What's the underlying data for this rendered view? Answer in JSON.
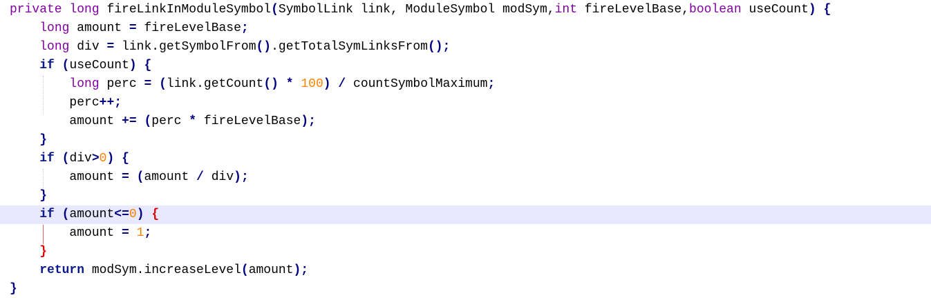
{
  "editor": {
    "language": "java",
    "current_line_index": 11,
    "colors": {
      "keyword_type": "#8000a0",
      "keyword_control": "#0a1a8c",
      "number": "#ff8000",
      "operator": "#000080",
      "text": "#000000",
      "matching_brace": "#e00000",
      "current_line_bg": "#e8e8ff"
    },
    "lines": [
      [
        {
          "t": "private",
          "c": "kw-purple"
        },
        {
          "t": " ",
          "c": "plain"
        },
        {
          "t": "long",
          "c": "kw-purple"
        },
        {
          "t": " fireLinkInModuleSymbol",
          "c": "plain"
        },
        {
          "t": "(",
          "c": "op"
        },
        {
          "t": "SymbolLink link, ModuleSymbol modSym,",
          "c": "plain"
        },
        {
          "t": "int",
          "c": "kw-purple"
        },
        {
          "t": " fireLevelBase,",
          "c": "plain"
        },
        {
          "t": "boolean",
          "c": "kw-purple"
        },
        {
          "t": " useCount",
          "c": "plain"
        },
        {
          "t": ")",
          "c": "op"
        },
        {
          "t": " ",
          "c": "plain"
        },
        {
          "t": "{",
          "c": "op"
        }
      ],
      [
        {
          "t": "    ",
          "c": "plain"
        },
        {
          "t": "long",
          "c": "kw-purple"
        },
        {
          "t": " amount ",
          "c": "plain"
        },
        {
          "t": "=",
          "c": "op"
        },
        {
          "t": " fireLevelBase",
          "c": "plain"
        },
        {
          "t": ";",
          "c": "op"
        }
      ],
      [
        {
          "t": "    ",
          "c": "plain"
        },
        {
          "t": "long",
          "c": "kw-purple"
        },
        {
          "t": " div ",
          "c": "plain"
        },
        {
          "t": "=",
          "c": "op"
        },
        {
          "t": " link.getSymbolFrom",
          "c": "plain"
        },
        {
          "t": "()",
          "c": "op"
        },
        {
          "t": ".getTotalSymLinksFrom",
          "c": "plain"
        },
        {
          "t": "();",
          "c": "op"
        }
      ],
      [
        {
          "t": "    ",
          "c": "plain"
        },
        {
          "t": "if",
          "c": "kw-navy"
        },
        {
          "t": " ",
          "c": "plain"
        },
        {
          "t": "(",
          "c": "op"
        },
        {
          "t": "useCount",
          "c": "plain"
        },
        {
          "t": ")",
          "c": "op"
        },
        {
          "t": " ",
          "c": "plain"
        },
        {
          "t": "{",
          "c": "op"
        }
      ],
      [
        {
          "t": "        ",
          "c": "plain"
        },
        {
          "t": "long",
          "c": "kw-purple"
        },
        {
          "t": " perc ",
          "c": "plain"
        },
        {
          "t": "=",
          "c": "op"
        },
        {
          "t": " ",
          "c": "plain"
        },
        {
          "t": "(",
          "c": "op"
        },
        {
          "t": "link.getCount",
          "c": "plain"
        },
        {
          "t": "()",
          "c": "op"
        },
        {
          "t": " ",
          "c": "plain"
        },
        {
          "t": "*",
          "c": "op"
        },
        {
          "t": " ",
          "c": "plain"
        },
        {
          "t": "100",
          "c": "num"
        },
        {
          "t": ")",
          "c": "op"
        },
        {
          "t": " ",
          "c": "plain"
        },
        {
          "t": "/",
          "c": "op"
        },
        {
          "t": " countSymbolMaximum",
          "c": "plain"
        },
        {
          "t": ";",
          "c": "op"
        }
      ],
      [
        {
          "t": "        ",
          "c": "plain"
        },
        {
          "t": "perc",
          "c": "plain"
        },
        {
          "t": "++;",
          "c": "op"
        }
      ],
      [
        {
          "t": "        ",
          "c": "plain"
        },
        {
          "t": "amount ",
          "c": "plain"
        },
        {
          "t": "+=",
          "c": "op"
        },
        {
          "t": " ",
          "c": "plain"
        },
        {
          "t": "(",
          "c": "op"
        },
        {
          "t": "perc ",
          "c": "plain"
        },
        {
          "t": "*",
          "c": "op"
        },
        {
          "t": " fireLevelBase",
          "c": "plain"
        },
        {
          "t": ");",
          "c": "op"
        }
      ],
      [
        {
          "t": "    ",
          "c": "plain"
        },
        {
          "t": "}",
          "c": "op"
        }
      ],
      [
        {
          "t": "    ",
          "c": "plain"
        },
        {
          "t": "if",
          "c": "kw-navy"
        },
        {
          "t": " ",
          "c": "plain"
        },
        {
          "t": "(",
          "c": "op"
        },
        {
          "t": "div",
          "c": "plain"
        },
        {
          "t": ">",
          "c": "op"
        },
        {
          "t": "0",
          "c": "num"
        },
        {
          "t": ")",
          "c": "op"
        },
        {
          "t": " ",
          "c": "plain"
        },
        {
          "t": "{",
          "c": "op"
        }
      ],
      [
        {
          "t": "        ",
          "c": "plain"
        },
        {
          "t": "amount ",
          "c": "plain"
        },
        {
          "t": "=",
          "c": "op"
        },
        {
          "t": " ",
          "c": "plain"
        },
        {
          "t": "(",
          "c": "op"
        },
        {
          "t": "amount ",
          "c": "plain"
        },
        {
          "t": "/",
          "c": "op"
        },
        {
          "t": " div",
          "c": "plain"
        },
        {
          "t": ");",
          "c": "op"
        }
      ],
      [
        {
          "t": "    ",
          "c": "plain"
        },
        {
          "t": "}",
          "c": "op"
        }
      ],
      [
        {
          "t": "    ",
          "c": "plain"
        },
        {
          "t": "if",
          "c": "kw-navy"
        },
        {
          "t": " ",
          "c": "plain"
        },
        {
          "t": "(",
          "c": "op"
        },
        {
          "t": "amount",
          "c": "plain"
        },
        {
          "t": "<=",
          "c": "op"
        },
        {
          "t": "0",
          "c": "num"
        },
        {
          "t": ")",
          "c": "op"
        },
        {
          "t": " ",
          "c": "plain"
        },
        {
          "t": "{",
          "c": "brace-red"
        }
      ],
      [
        {
          "t": "        ",
          "c": "plain"
        },
        {
          "t": "amount ",
          "c": "plain"
        },
        {
          "t": "=",
          "c": "op"
        },
        {
          "t": " ",
          "c": "plain"
        },
        {
          "t": "1",
          "c": "num"
        },
        {
          "t": ";",
          "c": "op"
        }
      ],
      [
        {
          "t": "    ",
          "c": "plain"
        },
        {
          "t": "}",
          "c": "brace-red"
        }
      ],
      [
        {
          "t": "    ",
          "c": "plain"
        },
        {
          "t": "return",
          "c": "kw-navy"
        },
        {
          "t": " modSym.increaseLevel",
          "c": "plain"
        },
        {
          "t": "(",
          "c": "op"
        },
        {
          "t": "amount",
          "c": "plain"
        },
        {
          "t": ");",
          "c": "op"
        }
      ],
      [
        {
          "t": "}",
          "c": "op"
        }
      ]
    ]
  }
}
